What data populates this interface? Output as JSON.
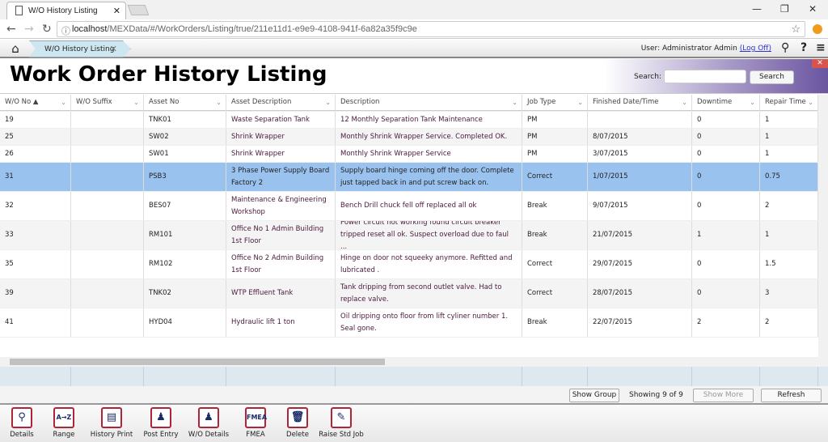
{
  "browser": {
    "tab_title": "W/O History Listing",
    "url_host": "localhost",
    "url_path": "/MEXData/#/WorkOrders/Listing/true/211e11d1-e9e9-4108-941f-6a82a35f9c9e"
  },
  "app": {
    "breadcrumb": "W/O History Listing",
    "user_label": "User: Administrator Admin",
    "logoff": "(Log Off)"
  },
  "page": {
    "title": "Work Order History Listing",
    "search_label": "Search:",
    "search_value": "",
    "search_button": "Search"
  },
  "columns": [
    "W/O No ▲",
    "W/O Suffix",
    "Asset No",
    "Asset Description",
    "Description",
    "Job Type",
    "Finished Date/Time",
    "Downtime",
    "Repair Time"
  ],
  "rows": [
    {
      "wo": "19",
      "suffix": "",
      "asset": "TNK01",
      "asset_desc": "Waste Separation Tank",
      "desc": "12 Monthly Separation Tank Maintenance",
      "job": "PM",
      "finished": "",
      "downtime": "0",
      "repair": "1"
    },
    {
      "wo": "25",
      "suffix": "",
      "asset": "SW02",
      "asset_desc": "Shrink Wrapper",
      "desc": "Monthly Shrink Wrapper Service. Completed OK.",
      "job": "PM",
      "finished": "8/07/2015",
      "downtime": "0",
      "repair": "1"
    },
    {
      "wo": "26",
      "suffix": "",
      "asset": "SW01",
      "asset_desc": "Shrink Wrapper",
      "desc": "Monthly Shrink Wrapper Service",
      "job": "PM",
      "finished": "3/07/2015",
      "downtime": "0",
      "repair": "1"
    },
    {
      "wo": "31",
      "suffix": "",
      "asset": "PSB3",
      "asset_desc": "3 Phase Power Supply Board Factory 2",
      "desc": "Supply board hinge coming off the door. Complete just tapped back in and put screw back on.",
      "job": "Correct",
      "finished": "1/07/2015",
      "downtime": "0",
      "repair": "0.75",
      "selected": true
    },
    {
      "wo": "32",
      "suffix": "",
      "asset": "BES07",
      "asset_desc": "Maintenance & Engineering Workshop",
      "desc": "Bench Drill chuck fell off replaced all ok",
      "job": "Break",
      "finished": "9/07/2015",
      "downtime": "0",
      "repair": "2"
    },
    {
      "wo": "33",
      "suffix": "",
      "asset": "RM101",
      "asset_desc": "Office No 1 Admin Building 1st Floor",
      "desc": "Power circuit not working found circuit breaker tripped reset all ok. Suspect overload due to faul ...",
      "job": "Break",
      "finished": "21/07/2015",
      "downtime": "1",
      "repair": "1"
    },
    {
      "wo": "35",
      "suffix": "",
      "asset": "RM102",
      "asset_desc": "Office No 2 Admin Building 1st Floor",
      "desc": "Hinge on door not squeeky anymore. Refitted and lubricated .",
      "job": "Correct",
      "finished": "29/07/2015",
      "downtime": "0",
      "repair": "1.5"
    },
    {
      "wo": "39",
      "suffix": "",
      "asset": "TNK02",
      "asset_desc": "WTP Effluent Tank",
      "desc": "Tank dripping from second outlet valve. Had to replace valve.",
      "job": "Correct",
      "finished": "28/07/2015",
      "downtime": "0",
      "repair": "3"
    },
    {
      "wo": "41",
      "suffix": "",
      "asset": "HYD04",
      "asset_desc": "Hydraulic lift 1 ton",
      "desc": "Oil dripping onto floor from lift cyliner number 1. Seal gone.",
      "job": "Break",
      "finished": "22/07/2015",
      "downtime": "2",
      "repair": "2"
    }
  ],
  "footer": {
    "show_group": "Show Group",
    "showing": "Showing 9 of 9",
    "show_more": "Show More",
    "refresh": "Refresh"
  },
  "toolbar": [
    {
      "label": "Details",
      "icon": "magnifier-icon",
      "glyph": "⚲"
    },
    {
      "label": "Range",
      "icon": "a-to-z-icon",
      "glyph": "A→Z"
    },
    {
      "label": "History Print",
      "icon": "printer-icon",
      "glyph": "▤"
    },
    {
      "label": "Post Entry",
      "icon": "person-icon",
      "glyph": "♟"
    },
    {
      "label": "W/O Details",
      "icon": "person-icon",
      "glyph": "♟"
    },
    {
      "label": "FMEA",
      "icon": "fmea-icon",
      "glyph": "FMEA"
    },
    {
      "label": "Delete",
      "icon": "trash-icon",
      "glyph": "🗑"
    },
    {
      "label": "Raise Std Job",
      "icon": "wrench-icon",
      "glyph": "✎"
    }
  ],
  "colors": {
    "selected_row": "#99c2ee",
    "tool_border": "#b0243a",
    "breadcrumb": "#cde6f0"
  }
}
